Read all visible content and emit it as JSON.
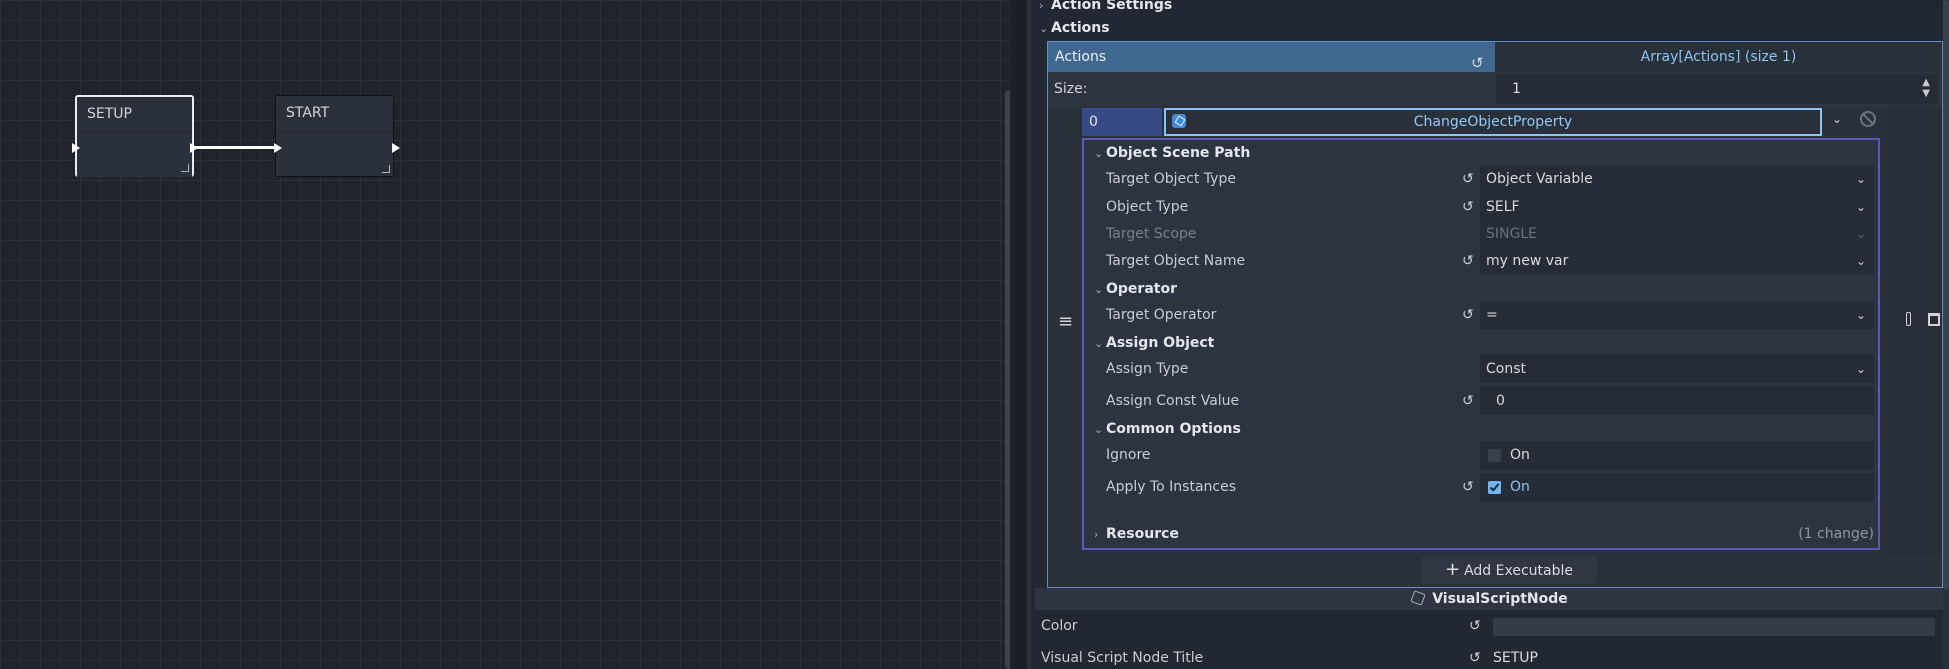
{
  "graph": {
    "nodes": [
      {
        "title": "SETUP",
        "selected": true
      },
      {
        "title": "START",
        "selected": false
      }
    ]
  },
  "inspector": {
    "section_action_settings": "Action Settings",
    "section_actions": "Actions",
    "array": {
      "name": "Actions",
      "type_label": "Array[Actions] (size 1)",
      "size_label": "Size:",
      "size_value": "1"
    },
    "element": {
      "index": "0",
      "resource_name": "ChangeObjectProperty",
      "categories": {
        "object_scene_path": "Object Scene Path",
        "operator": "Operator",
        "assign_object": "Assign Object",
        "common_options": "Common Options",
        "resource": "Resource"
      },
      "props": {
        "target_object_type": {
          "label": "Target Object Type",
          "value": "Object Variable"
        },
        "object_type": {
          "label": "Object Type",
          "value": "SELF"
        },
        "target_scope": {
          "label": "Target Scope",
          "value": "SINGLE"
        },
        "target_object_name": {
          "label": "Target Object Name",
          "value": "my new var"
        },
        "target_operator": {
          "label": "Target Operator",
          "value": "="
        },
        "assign_type": {
          "label": "Assign Type",
          "value": "Const"
        },
        "assign_const_value": {
          "label": "Assign Const Value",
          "value": "0"
        },
        "ignore": {
          "label": "Ignore",
          "value": "On",
          "checked": false
        },
        "apply_to_instances": {
          "label": "Apply To Instances",
          "value": "On",
          "checked": true
        }
      },
      "resource_changes": "(1 change)"
    },
    "add_button": "Add Executable Action",
    "node_section": "VisualScriptNode",
    "color_label": "Color",
    "title_label": "Visual Script Node Title",
    "title_value": "SETUP"
  },
  "icons": {
    "revert": "revert-icon",
    "resource": "resource-cube-icon",
    "clear": "clear-icon",
    "pin": "pin-icon",
    "trash": "trash-icon",
    "drag": "drag-handle-icon"
  },
  "colors": {
    "accent": "#8cc3f3",
    "selected_header": "#3f678f",
    "element_border": "#5b58b9"
  }
}
